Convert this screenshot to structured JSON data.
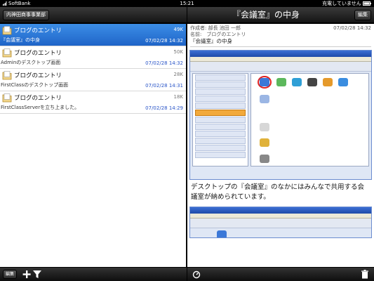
{
  "status": {
    "carrier": "SoftBank",
    "time": "15:21",
    "charging": "充電していません"
  },
  "master": {
    "back_label": "内神田商事事業部"
  },
  "detail_nav": {
    "title": "『会議室』の中身",
    "edit_label": "編集"
  },
  "list": [
    {
      "title": "ブログのエントリ",
      "size": "49K",
      "subtitle": "『会議室』の中身",
      "date": "07/02/28 14:32",
      "selected": true
    },
    {
      "title": "ブログのエントリ",
      "size": "50K",
      "subtitle": "Adminのデスクトップ画面",
      "date": "07/02/28 14:32",
      "selected": false
    },
    {
      "title": "ブログのエントリ",
      "size": "28K",
      "subtitle": "FirstClassのデスクトップ画面",
      "date": "07/02/28 14:31",
      "selected": false
    },
    {
      "title": "ブログのエントリ",
      "size": "18K",
      "subtitle": "FirstClassServerを立ち上ました。",
      "date": "07/02/28 14:29",
      "selected": false
    }
  ],
  "detail": {
    "author": "作成者: 部長 池田 一郎",
    "name": "名前:　ブログのエントリ",
    "date": "07/02/28 14:32",
    "subject": "『会議室』の中身",
    "body": "デスクトップの『会議室』のなかにはみんなで共用する会議室が納められています。"
  },
  "bottom_left": {
    "edit_label": "編集"
  },
  "colors": {
    "selected_row": "#1f64c8",
    "date_blue": "#2a55c8",
    "nav_bar": "#1f1f1f"
  }
}
